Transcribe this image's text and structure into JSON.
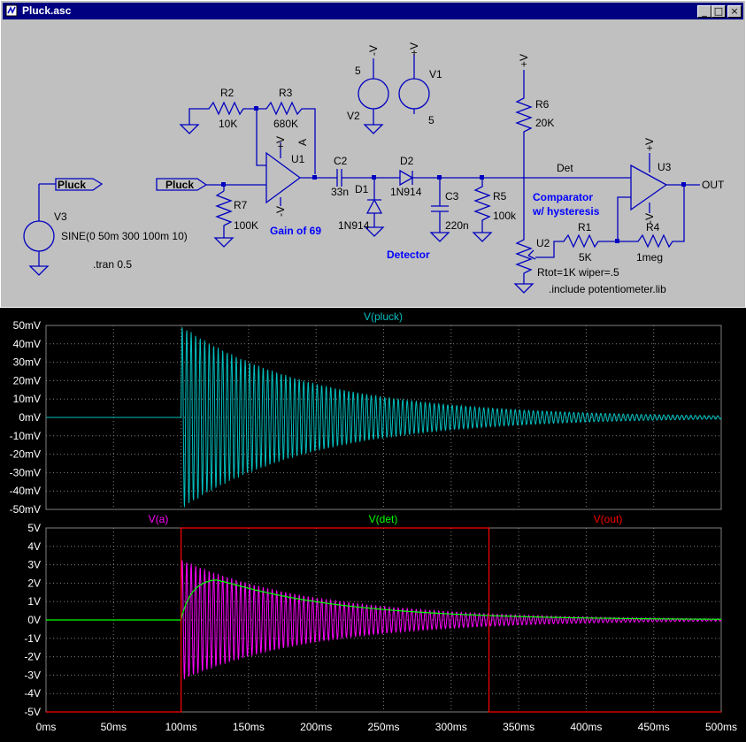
{
  "window": {
    "title": "Pluck.asc",
    "controls": [
      "_",
      "□",
      "×"
    ]
  },
  "schematic": {
    "labels": {
      "v3": "V3",
      "v3_value": "SINE(0 50m 300 100m 10)",
      "tran": ".tran 0.5",
      "pluck_left": "Pluck",
      "pluck_in": "Pluck",
      "r7": "R7",
      "r7_value": "100K",
      "r2": "R2",
      "r2_value": "10K",
      "r3": "R3",
      "r3_value": "680K",
      "u1": "U1",
      "node_a": "A",
      "gain": "Gain of 69",
      "vplus1": "+V",
      "vminus1": "-V",
      "c2": "C2",
      "c2_value": "33n",
      "d1": "D1",
      "d1_value": "1N914",
      "d2": "D2",
      "d2_value": "1N914",
      "c3": "C3",
      "c3_value": "220n",
      "r5": "R5",
      "r5_value": "100k",
      "detector": "Detector",
      "v2": "V2",
      "v2_value": "5",
      "v2_node": "-V",
      "v1": "V1",
      "v1_value": "5",
      "v1_node": "+V",
      "r6": "R6",
      "r6_value": "20K",
      "r6_node": "+V",
      "det": "Det",
      "comparator": "Comparator",
      "hysteresis": "w/ hysteresis",
      "u3": "U3",
      "out": "OUT",
      "vplus3": "+V",
      "vminus3": "-V",
      "r1": "R1",
      "r1_value": "5K",
      "r4": "R4",
      "r4_value": "1meg",
      "u2": "U2",
      "u2_value": "Rtot=1K wiper=.5",
      "include": ".include potentiometer.lib"
    }
  },
  "colors": {
    "schematic_wire": "#0000c0",
    "label_blue": "#0000ff",
    "plot_bg": "#000000",
    "grid": "#808080",
    "pluck": "#00c0c0",
    "a": "#ff00ff",
    "det": "#00ff00",
    "out": "#ff0000"
  },
  "chart_data": [
    {
      "type": "line",
      "title": "V(pluck)",
      "series": [
        {
          "name": "V(pluck)",
          "description": "damped sine: 0 before 100ms, then 50mV * sin(2π·300·(t-0.1)) * exp(-(t-0.1)/0.1)"
        }
      ],
      "x_ticks": [
        "0ms",
        "50ms",
        "100ms",
        "150ms",
        "200ms",
        "250ms",
        "300ms",
        "350ms",
        "400ms",
        "450ms",
        "500ms"
      ],
      "y_ticks": [
        "50mV",
        "40mV",
        "30mV",
        "20mV",
        "10mV",
        "0mV",
        "-10mV",
        "-20mV",
        "-30mV",
        "-40mV",
        "-50mV"
      ],
      "xlim": [
        0,
        500
      ],
      "ylim": [
        -50,
        50
      ],
      "grid": true
    },
    {
      "type": "line",
      "series": [
        {
          "name": "V(a)",
          "description": "amplified pluck: gain 69, about ±3.3V envelope decaying from 100ms"
        },
        {
          "name": "V(det)",
          "description": "detector envelope peaking ≈2.2V at ~125ms, decaying to ≈0.1V at 500ms"
        },
        {
          "name": "V(out)",
          "description": "comparator output: -5V before 100ms, +5V from 100ms to ≈328ms, then -5V"
        }
      ],
      "x_ticks": [
        "0ms",
        "50ms",
        "100ms",
        "150ms",
        "200ms",
        "250ms",
        "300ms",
        "350ms",
        "400ms",
        "450ms",
        "500ms"
      ],
      "y_ticks": [
        "5V",
        "4V",
        "3V",
        "2V",
        "1V",
        "0V",
        "-1V",
        "-2V",
        "-3V",
        "-4V",
        "-5V"
      ],
      "xlim": [
        0,
        500
      ],
      "ylim": [
        -5,
        5
      ],
      "grid": true
    }
  ]
}
